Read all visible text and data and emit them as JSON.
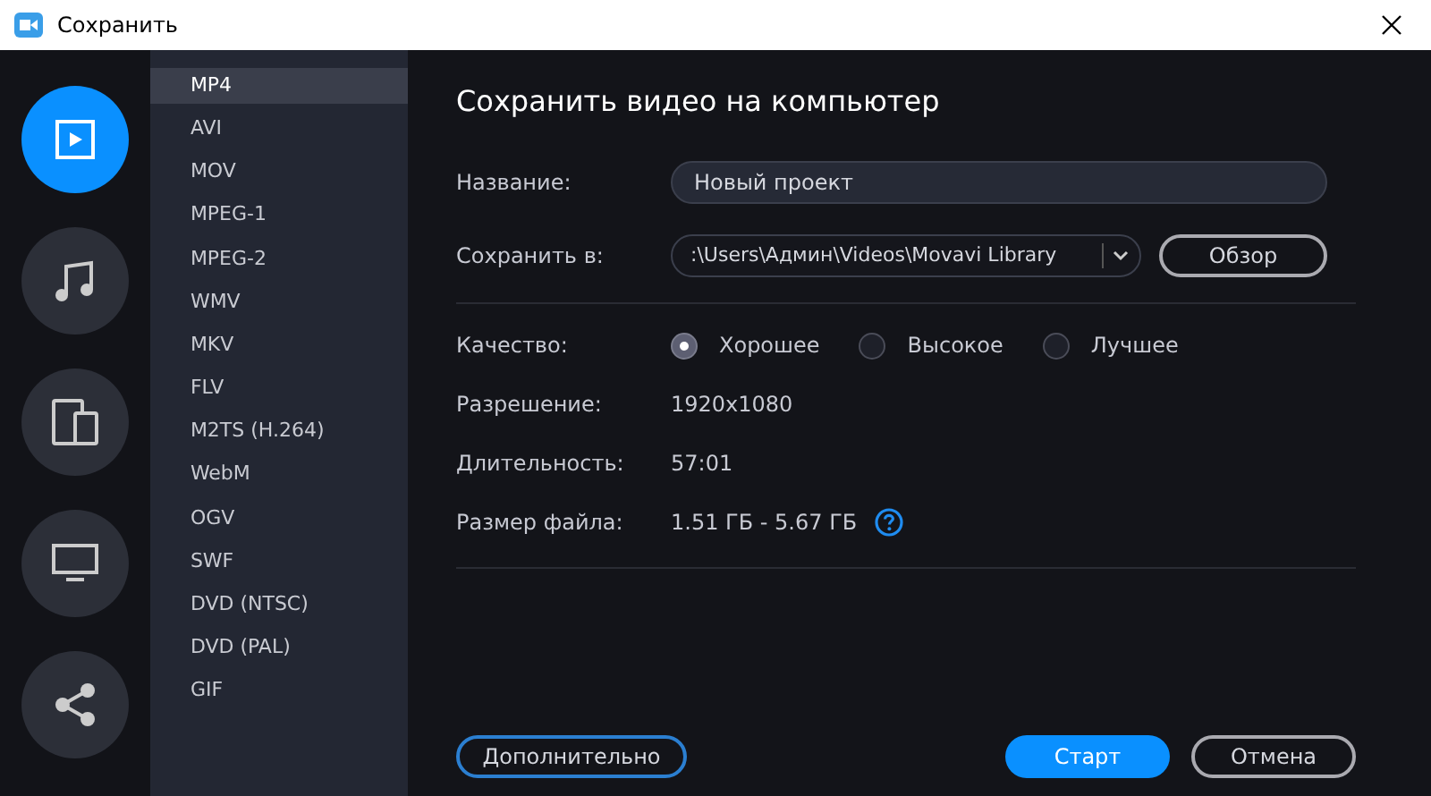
{
  "window": {
    "title": "Сохранить"
  },
  "categories": [
    {
      "kind": "video",
      "selected": true
    },
    {
      "kind": "audio",
      "selected": false
    },
    {
      "kind": "devices",
      "selected": false
    },
    {
      "kind": "tv",
      "selected": false
    },
    {
      "kind": "share",
      "selected": false
    }
  ],
  "formats": [
    {
      "label": "MP4",
      "selected": true
    },
    {
      "label": "AVI",
      "selected": false
    },
    {
      "label": "MOV",
      "selected": false
    },
    {
      "label": "MPEG-1",
      "selected": false
    },
    {
      "label": "MPEG-2",
      "selected": false
    },
    {
      "label": "WMV",
      "selected": false
    },
    {
      "label": "MKV",
      "selected": false
    },
    {
      "label": "FLV",
      "selected": false
    },
    {
      "label": "M2TS (H.264)",
      "selected": false
    },
    {
      "label": "WebM",
      "selected": false
    },
    {
      "label": "OGV",
      "selected": false
    },
    {
      "label": "SWF",
      "selected": false
    },
    {
      "label": "DVD (NTSC)",
      "selected": false
    },
    {
      "label": "DVD (PAL)",
      "selected": false
    },
    {
      "label": "GIF",
      "selected": false
    }
  ],
  "heading": "Сохранить видео на компьютер",
  "name_field": {
    "label": "Название:",
    "value": "Новый проект"
  },
  "save_to": {
    "label": "Сохранить в:",
    "value": ":\\Users\\Админ\\Videos\\Movavi Library",
    "browse": "Обзор"
  },
  "quality": {
    "label": "Качество:",
    "options": [
      {
        "label": "Хорошее",
        "selected": true
      },
      {
        "label": "Высокое",
        "selected": false
      },
      {
        "label": "Лучшее",
        "selected": false
      }
    ]
  },
  "info": [
    {
      "label": "Разрешение:",
      "value": "1920x1080"
    },
    {
      "label": "Длительность:",
      "value": "57:01"
    },
    {
      "label": "Размер файла:",
      "value": "1.51 ГБ - 5.67 ГБ",
      "help": true
    }
  ],
  "buttons": {
    "advanced": "Дополнительно",
    "start": "Старт",
    "cancel": "Отмена"
  }
}
